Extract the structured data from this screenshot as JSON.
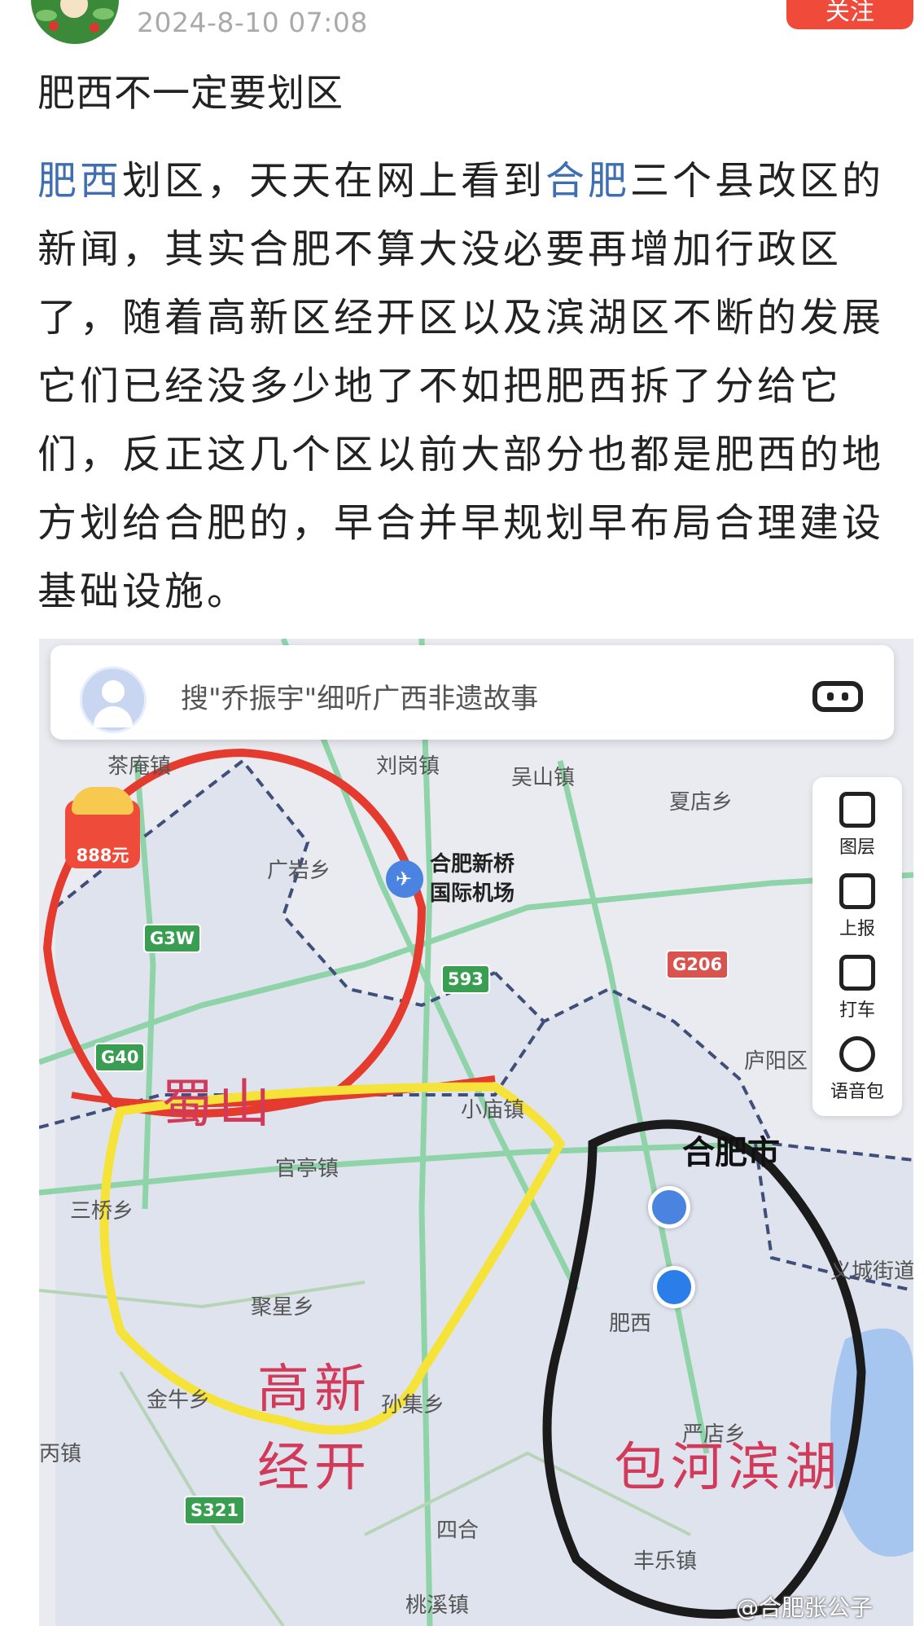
{
  "post": {
    "timestamp": "2024-8-10 07:08",
    "follow_label": "关注",
    "title": "肥西不一定要划区",
    "body_link_1": "肥西",
    "body_part_1": "划区，天天在网上看到",
    "body_link_2": "合肥",
    "body_part_2": "三个县改区的新闻，其实合肥不算大没必要再增加行政区了，随着高新区经开区以及滨湖区不断的发展它们已经没多少地了不如把肥西拆了分给它们，反正这几个区以前大部分也都是肥西的地方划给合肥的，早合并早规划早布局合理建设基础设施。"
  },
  "map": {
    "search_text": "搜\"乔振宇\"细听广西非遗故事",
    "redpacket_label": "888元",
    "toolbar": {
      "layers": "图层",
      "report": "上报",
      "taxi": "打车",
      "voice": "语音包"
    },
    "places": {
      "chaling": "茶庵镇",
      "liugang": "刘岗镇",
      "wushan": "吴山镇",
      "xiadian": "夏店乡",
      "guangyan": "广岩乡",
      "airport_1": "合肥新桥",
      "airport_2": "国际机场",
      "lujiang": "庐阳区",
      "xiaomiao": "小庙镇",
      "hefei": "合肥市",
      "guanting": "官亭镇",
      "taqiao": "三桥乡",
      "yicheng": "义城街道",
      "juxing": "聚星乡",
      "feixi": "肥西",
      "jinniu": "金牛乡",
      "sunji": "孙集乡",
      "yandian": "严店乡",
      "zhen_left": "丙镇",
      "sihe": "四合",
      "fengle": "丰乐镇",
      "taoxi": "桃溪镇"
    },
    "roads": {
      "g3w": "G3W",
      "g40": "G40",
      "s593": "593",
      "g206": "G206",
      "s321": "S321"
    },
    "handwriting": {
      "shushan": "蜀山",
      "gaoxin_1": "高新",
      "gaoxin_2": "经开",
      "baohe": "包河滨湖"
    },
    "watermark": "@合肥张公子"
  }
}
